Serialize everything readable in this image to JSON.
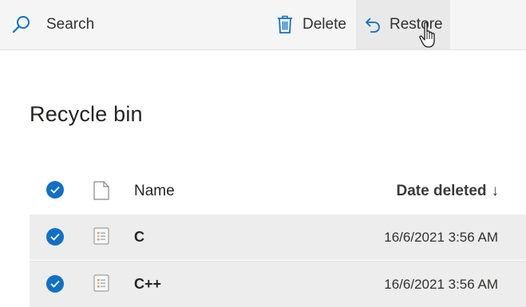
{
  "toolbar": {
    "search_label": "Search",
    "delete_label": "Delete",
    "restore_label": "Restore"
  },
  "page": {
    "title": "Recycle bin"
  },
  "list": {
    "columns": {
      "name": "Name",
      "date_deleted": "Date deleted",
      "sort_indicator": "↓"
    },
    "rows": [
      {
        "name": "C",
        "date_deleted": "16/6/2021 3:56 AM",
        "selected": true
      },
      {
        "name": "C++",
        "date_deleted": "16/6/2021 3:56 AM",
        "selected": true
      }
    ]
  },
  "colors": {
    "accent": "#1170c4",
    "toolbar_bg": "#f5f5f5",
    "selected_row_bg": "#ededed"
  }
}
